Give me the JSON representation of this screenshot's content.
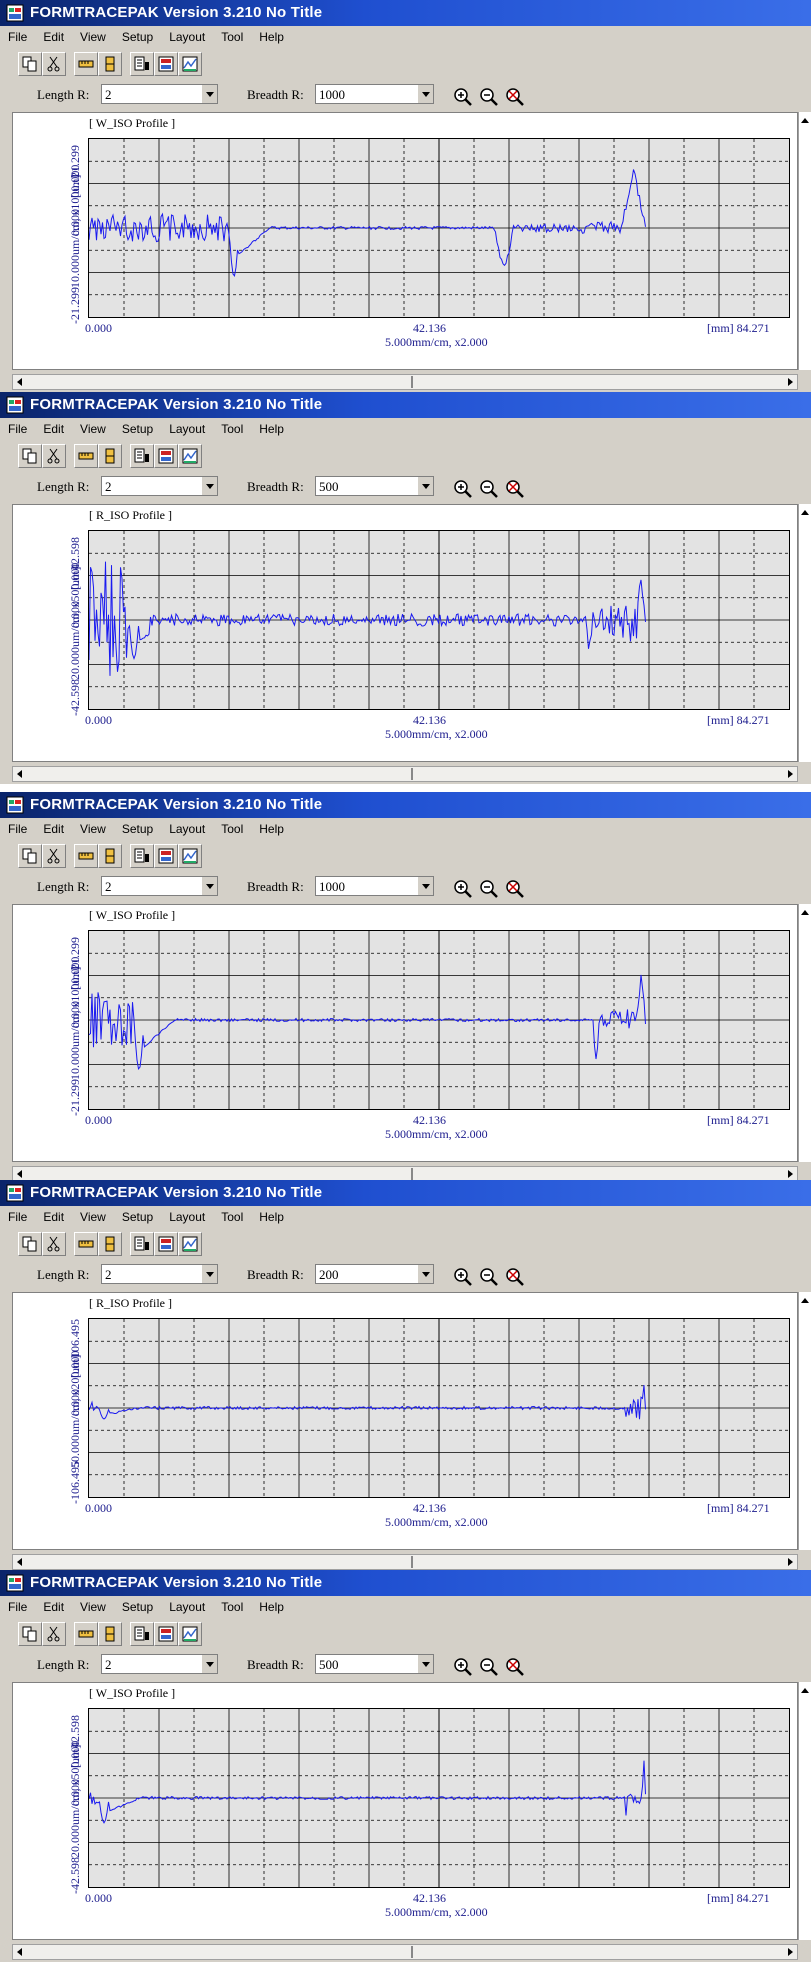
{
  "app": {
    "title": "FORMTRACEPAK Version 3.210   No Title"
  },
  "menu": [
    "File",
    "Edit",
    "View",
    "Setup",
    "Layout",
    "Tool",
    "Help"
  ],
  "labels": {
    "length": "Length R:",
    "breadth": "Breadth R:"
  },
  "x_axis": {
    "left": "0.000",
    "mid": "42.136",
    "right": "[mm] 84.271",
    "scale": "5.000mm/cm, x2.000"
  },
  "icons": {
    "toolbar": [
      "copy-icon",
      "cut-icon",
      "ruler-icon",
      "bar-gauge-icon",
      "chart-list-icon",
      "report-icon",
      "layout-icon"
    ],
    "zoom": [
      "zoom-in-icon",
      "zoom-out-icon",
      "zoom-reset-icon"
    ]
  },
  "colors": {
    "title_bar": "#0a246a",
    "profile_line": "#1a1af0",
    "axis_text": "#1a1a8c",
    "grid_bg": "#e3e3e3"
  },
  "panels": [
    {
      "profile": "[ W_ISO Profile ]",
      "length_value": "2",
      "breadth_value": "1000",
      "y_scale": "10.000um/cm, x1000.000",
      "y_unit": "[um]",
      "y_top": "21.299",
      "y_mid": "0.000",
      "y_bottom": "-21.299"
    },
    {
      "profile": "[ R_ISO Profile ]",
      "length_value": "2",
      "breadth_value": "500",
      "y_scale": "20.000um/cm, x500.000",
      "y_unit": "[um]",
      "y_top": "42.598",
      "y_mid": "0.000",
      "y_bottom": "-42.598"
    },
    {
      "profile": "[ W_ISO Profile ]",
      "length_value": "2",
      "breadth_value": "1000",
      "y_scale": "10.000um/cm, x1000.000",
      "y_unit": "[um]",
      "y_top": "21.299",
      "y_mid": "0.000",
      "y_bottom": "-21.299"
    },
    {
      "profile": "[ R_ISO Profile ]",
      "length_value": "2",
      "breadth_value": "200",
      "y_scale": "50.000um/cm, x200.000",
      "y_unit": "[um]",
      "y_top": "106.495",
      "y_mid": "0.000",
      "y_bottom": "-106.495"
    },
    {
      "profile": "[ W_ISO Profile ]",
      "length_value": "2",
      "breadth_value": "500",
      "y_scale": "20.000um/cm, x500.000",
      "y_unit": "[um]",
      "y_top": "42.598",
      "y_mid": "0.000",
      "y_bottom": "-42.598"
    }
  ]
}
